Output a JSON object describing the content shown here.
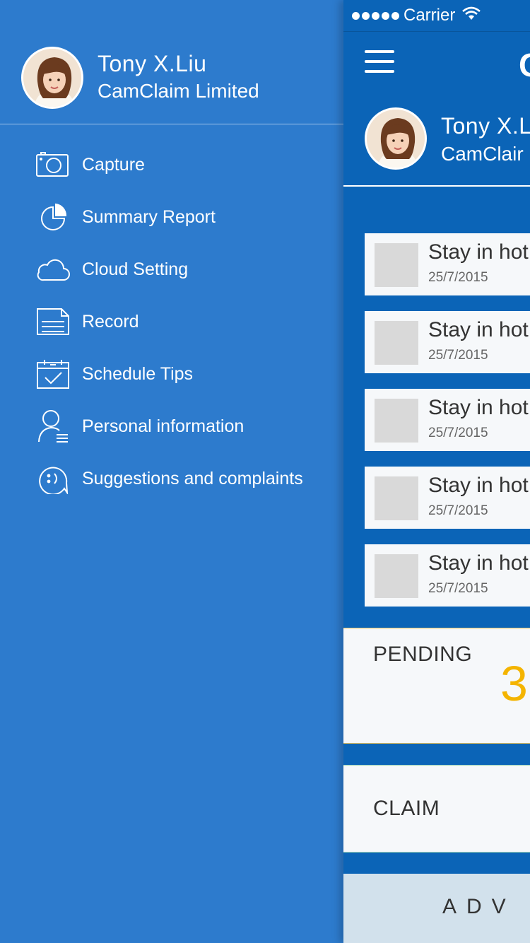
{
  "user": {
    "name": "Tony X.Liu",
    "company": "CamClaim Limited"
  },
  "drawer": {
    "menu": [
      {
        "label": "Capture",
        "icon": "camera-icon"
      },
      {
        "label": "Summary Report",
        "icon": "pie-chart-icon"
      },
      {
        "label": "Cloud Setting",
        "icon": "cloud-icon"
      },
      {
        "label": "Record",
        "icon": "document-icon"
      },
      {
        "label": "Schedule Tips",
        "icon": "calendar-check-icon"
      },
      {
        "label": "Personal information",
        "icon": "person-list-icon"
      },
      {
        "label": "Suggestions and complaints",
        "icon": "chat-smile-icon"
      }
    ]
  },
  "main": {
    "status_bar": {
      "carrier": "Carrier"
    },
    "nav_title_partial": "C",
    "profile": {
      "name_partial": "Tony X.L",
      "company_partial": "CamClair"
    },
    "records": [
      {
        "title": "Stay in hot",
        "date": "25/7/2015"
      },
      {
        "title": "Stay in hot",
        "date": "25/7/2015"
      },
      {
        "title": "Stay in hot",
        "date": "25/7/2015"
      },
      {
        "title": "Stay in hot",
        "date": "25/7/2015"
      },
      {
        "title": "Stay in hot",
        "date": "25/7/2015"
      }
    ],
    "pending": {
      "label": "PENDING",
      "count": "3"
    },
    "claim": {
      "label": "CLAIM"
    },
    "ad_text": "ADV"
  },
  "colors": {
    "drawer_bg": "#2d7bcd",
    "main_bg": "#0b64b7",
    "pending_count": "#f4b400",
    "card_bg": "#f6f8fa",
    "ad_bar_bg": "#d2e1ec"
  }
}
